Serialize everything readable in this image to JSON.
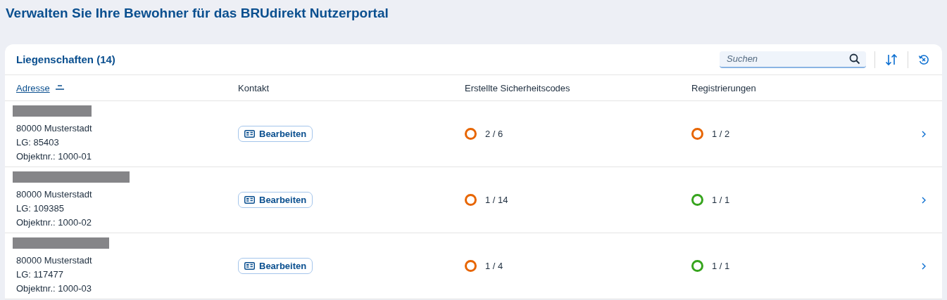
{
  "page_title": "Verwalten Sie Ihre Bewohner für das BRUdirekt Nutzerportal",
  "table": {
    "title": "Liegenschaften (14)",
    "search": {
      "placeholder": "Suchen"
    },
    "columns": [
      {
        "label": "Adresse",
        "sorted": true
      },
      {
        "label": "Kontakt",
        "sorted": false
      },
      {
        "label": "Erstellte Sicherheitscodes",
        "sorted": false
      },
      {
        "label": "Registrierungen",
        "sorted": false
      }
    ],
    "rows": [
      {
        "address_lines": [
          "80000 Musterstadt",
          "LG: 85403",
          "Objektnr.: 1000-01"
        ],
        "contact_button": "Bearbeiten",
        "codes": {
          "text": "2 / 6",
          "color": "#e76500"
        },
        "registrations": {
          "text": "1 / 2",
          "color": "#e76500"
        }
      },
      {
        "address_lines": [
          "80000 Musterstadt",
          "LG: 109385",
          "Objektnr.: 1000-02"
        ],
        "contact_button": "Bearbeiten",
        "codes": {
          "text": "1 / 14",
          "color": "#e76500"
        },
        "registrations": {
          "text": "1 / 1",
          "color": "#36a41d"
        }
      },
      {
        "address_lines": [
          "80000 Musterstadt",
          "LG: 117477",
          "Objektnr.: 1000-03"
        ],
        "contact_button": "Bearbeiten",
        "codes": {
          "text": "1 / 4",
          "color": "#e76500"
        },
        "registrations": {
          "text": "1 / 1",
          "color": "#36a41d"
        }
      }
    ]
  }
}
